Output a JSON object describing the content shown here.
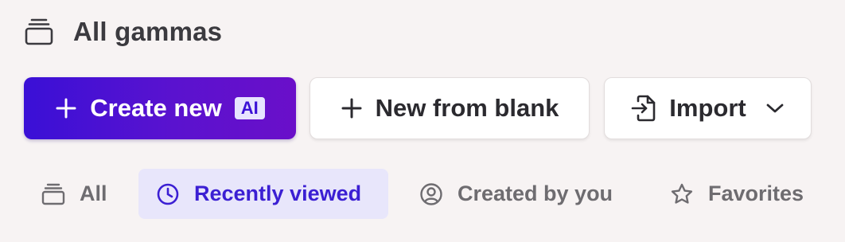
{
  "header": {
    "title": "All gammas",
    "icon": "stack-icon"
  },
  "actions": {
    "create_label": "Create new",
    "create_badge": "AI",
    "blank_label": "New from blank",
    "import_label": "Import"
  },
  "tabs": [
    {
      "label": "All",
      "icon": "stack-icon",
      "active": false
    },
    {
      "label": "Recently viewed",
      "icon": "clock-icon",
      "active": true
    },
    {
      "label": "Created by you",
      "icon": "user-circle-icon",
      "active": false
    },
    {
      "label": "Favorites",
      "icon": "star-icon",
      "active": false
    }
  ],
  "colors": {
    "accent": "#3a10d6",
    "background": "#f7f3f3",
    "active_tab_bg": "#e8e6fb"
  }
}
